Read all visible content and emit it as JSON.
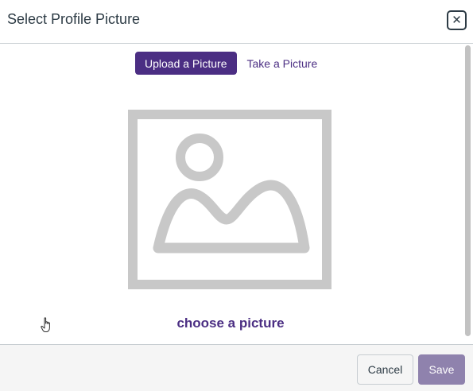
{
  "dialog": {
    "title": "Select Profile Picture",
    "close_icon": "close-icon"
  },
  "tabs": [
    {
      "label": "Upload a Picture",
      "active": true
    },
    {
      "label": "Take a Picture",
      "active": false
    }
  ],
  "placeholder": {
    "icon": "image-placeholder-icon",
    "link_label": "choose a picture"
  },
  "footer": {
    "cancel_label": "Cancel",
    "save_label": "Save"
  },
  "colors": {
    "accent": "#4b2e83",
    "save_disabled": "#8f82ad",
    "placeholder_gray": "#c8c8c8"
  }
}
